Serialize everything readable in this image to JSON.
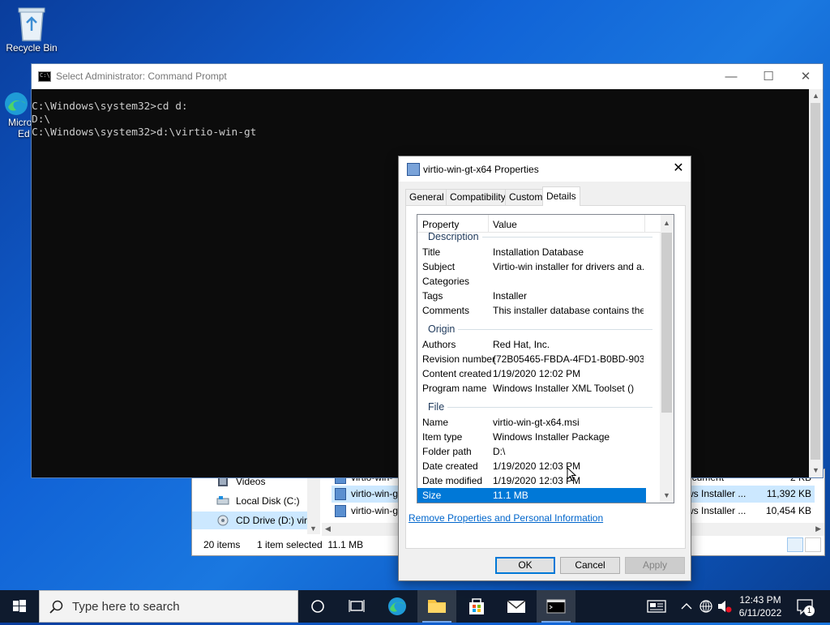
{
  "desktop": {
    "recycle_bin_label": "Recycle Bin",
    "edge_label_line1": "Micro",
    "edge_label_line2": "Ed"
  },
  "cmd": {
    "title": "Select Administrator: Command Prompt",
    "icon_text": "C:\\",
    "lines": [
      "C:\\Windows\\system32>cd d:",
      "D:\\",
      "",
      "C:\\Windows\\system32>d:\\virtio-win-gt"
    ],
    "minimize": "—",
    "maximize": "☐",
    "close": "✕"
  },
  "explorer": {
    "nav": [
      {
        "label": "Videos"
      },
      {
        "label": "Local Disk (C:)"
      },
      {
        "label": "CD Drive (D:) virt"
      }
    ],
    "files": [
      {
        "name": "virtio-win-",
        "type": "ocument",
        "size": "2 KB"
      },
      {
        "name": "virtio-win-g",
        "type": "ws Installer ...",
        "size": "11,392 KB"
      },
      {
        "name": "virtio-win-g",
        "type": "ws Installer ...",
        "size": "10,454 KB"
      }
    ],
    "status_items": "20 items",
    "status_selected": "1 item selected  11.1 MB"
  },
  "props": {
    "title": "virtio-win-gt-x64 Properties",
    "close": "✕",
    "tabs": [
      "General",
      "Compatibility",
      "Custom",
      "Details"
    ],
    "columns": {
      "property": "Property",
      "value": "Value"
    },
    "partial_group": "Description",
    "rows_description": [
      {
        "k": "Title",
        "v": "Installation Database"
      },
      {
        "k": "Subject",
        "v": "Virtio-win installer for drivers and a..."
      },
      {
        "k": "Categories",
        "v": ""
      },
      {
        "k": "Tags",
        "v": "Installer"
      },
      {
        "k": "Comments",
        "v": "This installer database contains the..."
      }
    ],
    "group_origin": "Origin",
    "rows_origin": [
      {
        "k": "Authors",
        "v": "Red Hat, Inc."
      },
      {
        "k": "Revision number",
        "v": "{72B05465-FBDA-4FD1-B0BD-903..."
      },
      {
        "k": "Content created",
        "v": "1/19/2020 12:02 PM"
      },
      {
        "k": "Program name",
        "v": "Windows Installer XML Toolset ()"
      }
    ],
    "group_file": "File",
    "rows_file": [
      {
        "k": "Name",
        "v": "virtio-win-gt-x64.msi"
      },
      {
        "k": "Item type",
        "v": "Windows Installer Package"
      },
      {
        "k": "Folder path",
        "v": "D:\\"
      },
      {
        "k": "Date created",
        "v": "1/19/2020 12:03 PM"
      },
      {
        "k": "Date modified",
        "v": "1/19/2020 12:03 PM"
      },
      {
        "k": "Size",
        "v": "11.1 MB"
      }
    ],
    "link": "Remove Properties and Personal Information",
    "ok": "OK",
    "cancel": "Cancel",
    "apply": "Apply"
  },
  "taskbar": {
    "search_placeholder": "Type here to search",
    "time": "12:43 PM",
    "date": "6/11/2022",
    "notification_count": "1"
  }
}
